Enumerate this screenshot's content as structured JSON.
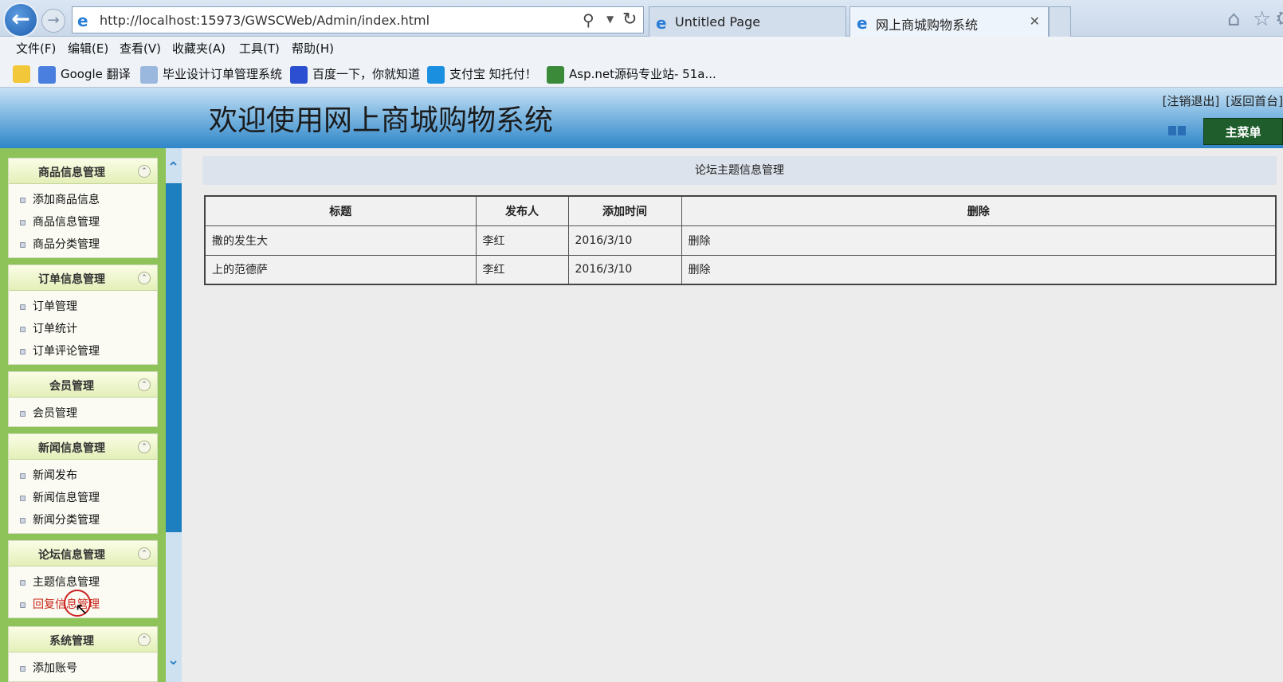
{
  "browser": {
    "address": "http://localhost:15973/GWSCWeb/Admin/index.html",
    "tabs": [
      {
        "label": "Untitled Page"
      },
      {
        "label": "网上商城购物系统"
      }
    ],
    "menu": [
      "文件(F)",
      "编辑(E)",
      "查看(V)",
      "收藏夹(A)",
      "工具(T)",
      "帮助(H)"
    ],
    "favorites": [
      "Google 翻译",
      "毕业设计订单管理系统",
      "百度一下，你就知道",
      "支付宝 知托付！",
      "Asp.net源码专业站- 51a..."
    ]
  },
  "header": {
    "title": "欢迎使用网上商城购物系统",
    "logout": "[注销退出]",
    "back": "[返回首台]",
    "main_menu": "主菜单"
  },
  "sidebar": {
    "groups": [
      {
        "title": "商品信息管理",
        "items": [
          "添加商品信息",
          "商品信息管理",
          "商品分类管理"
        ]
      },
      {
        "title": "订单信息管理",
        "items": [
          "订单管理",
          "订单统计",
          "订单评论管理"
        ]
      },
      {
        "title": "会员管理",
        "items": [
          "会员管理"
        ]
      },
      {
        "title": "新闻信息管理",
        "items": [
          "新闻发布",
          "新闻信息管理",
          "新闻分类管理"
        ]
      },
      {
        "title": "论坛信息管理",
        "items": [
          "主题信息管理",
          "回复信息管理"
        ]
      },
      {
        "title": "系统管理",
        "items": [
          "添加账号"
        ]
      }
    ]
  },
  "main": {
    "panel_title": "论坛主题信息管理",
    "columns": [
      "标题",
      "发布人",
      "添加时间",
      "删除"
    ],
    "rows": [
      {
        "title": "撒的发生大",
        "author": "李红",
        "date": "2016/3/10",
        "action": "删除"
      },
      {
        "title": "上的范德萨",
        "author": "李红",
        "date": "2016/3/10",
        "action": "删除"
      }
    ]
  }
}
